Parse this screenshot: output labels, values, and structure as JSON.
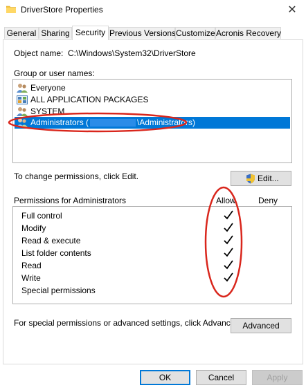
{
  "window": {
    "title": "DriverStore Properties",
    "close_glyph": "✕"
  },
  "tabs": [
    {
      "label": "General"
    },
    {
      "label": "Sharing"
    },
    {
      "label": "Security"
    },
    {
      "label": "Previous Versions"
    },
    {
      "label": "Customize"
    },
    {
      "label": "Acronis Recovery"
    }
  ],
  "object_name": {
    "label": "Object name:",
    "value": "C:\\Windows\\System32\\DriverStore"
  },
  "group_label": "Group or user names:",
  "users": [
    {
      "name": "Everyone",
      "icon": "users-icon"
    },
    {
      "name": "ALL APPLICATION PACKAGES",
      "icon": "packages-icon"
    },
    {
      "name": "SYSTEM",
      "icon": "users-icon"
    },
    {
      "name_prefix": "Administrators (",
      "name_suffix": "\\Administrators)",
      "icon": "users-icon",
      "selected": true
    }
  ],
  "change_text": "To change permissions, click Edit.",
  "edit_button": "Edit...",
  "permissions": {
    "header": "Permissions for Administrators",
    "allow_label": "Allow",
    "deny_label": "Deny",
    "rows": [
      {
        "name": "Full control",
        "allow": true,
        "deny": false
      },
      {
        "name": "Modify",
        "allow": true,
        "deny": false
      },
      {
        "name": "Read & execute",
        "allow": true,
        "deny": false
      },
      {
        "name": "List folder contents",
        "allow": true,
        "deny": false
      },
      {
        "name": "Read",
        "allow": true,
        "deny": false
      },
      {
        "name": "Write",
        "allow": true,
        "deny": false
      },
      {
        "name": "Special permissions",
        "allow": false,
        "deny": false
      }
    ]
  },
  "advanced_text": "For special permissions or advanced settings, click Advanced.",
  "advanced_button": "Advanced",
  "footer": {
    "ok": "OK",
    "cancel": "Cancel",
    "apply": "Apply"
  },
  "colors": {
    "selection": "#0078d7",
    "annotation": "#d9261c"
  }
}
